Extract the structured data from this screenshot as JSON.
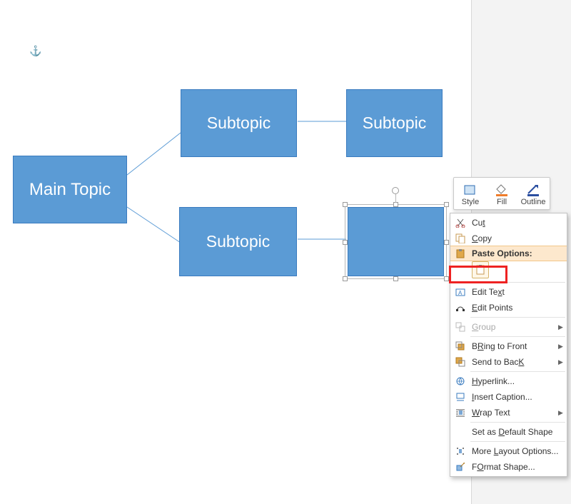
{
  "anchor_glyph": "⚓",
  "shapes": {
    "main": "Main Topic",
    "sub1": "Subtopic",
    "sub2": "Subtopic",
    "sub3": "Subtopic",
    "sub4": ""
  },
  "mini_toolbar": {
    "style": "Style",
    "fill": "Fill",
    "outline": "Outline"
  },
  "context_menu": {
    "cut": "Cut",
    "copy": "Copy",
    "paste_options": "Paste Options:",
    "edit_text": "Edit Text",
    "edit_points": "Edit Points",
    "group": "Group",
    "bring_to_front": "Bring to Front",
    "send_to_back": "Send to Back",
    "hyperlink": "Hyperlink...",
    "insert_caption": "Insert Caption...",
    "wrap_text": "Wrap Text",
    "set_default": "Set as Default Shape",
    "more_layout": "More Layout Options...",
    "format_shape": "Format Shape..."
  },
  "accel": {
    "cut": "t",
    "copy": "C",
    "edit_text": "x",
    "edit_points": "E",
    "group": "G",
    "bring_to_front": "R",
    "send_to_back": "K",
    "hyperlink": "H",
    "insert_caption": "I",
    "wrap_text": "W",
    "set_default": "D",
    "more_layout": "L",
    "format_shape": "O"
  }
}
